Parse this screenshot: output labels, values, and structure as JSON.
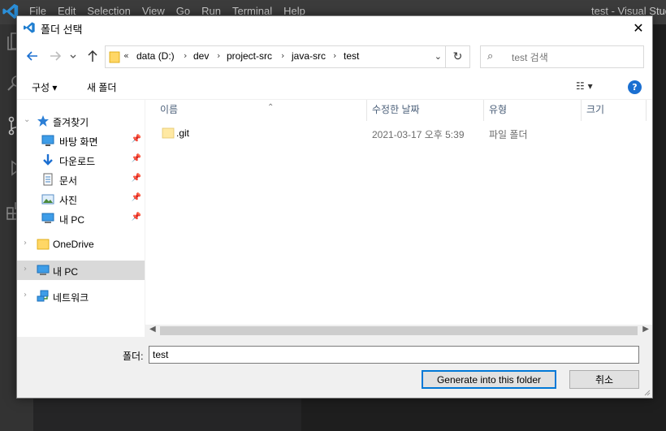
{
  "vscode": {
    "menu": [
      "File",
      "Edit",
      "Selection",
      "View",
      "Go",
      "Run",
      "Terminal",
      "Help"
    ],
    "window_title": "test - Visual Studi"
  },
  "dialog": {
    "title": "폴더 선택",
    "close": "✕",
    "address": {
      "overflow": "«",
      "crumbs": [
        "data (D:)",
        "dev",
        "project-src",
        "java-src",
        "test"
      ]
    },
    "search": {
      "placeholder": "test 검색"
    },
    "toolbar": {
      "organize": "구성 ▾",
      "new_folder": "새 폴더",
      "help": "?"
    },
    "nav_tree": {
      "quick_access": "즐겨찾기",
      "desktop": "바탕 화면",
      "downloads": "다운로드",
      "documents": "문서",
      "pictures": "사진",
      "this_pc_pinned": "내 PC",
      "onedrive": "OneDrive",
      "this_pc": "내 PC",
      "network": "네트워크"
    },
    "columns": {
      "name": "이름",
      "modified": "수정한 날짜",
      "type": "유형",
      "size": "크기"
    },
    "files": [
      {
        "name": ".git",
        "modified": "2021-03-17 오후 5:39",
        "type": "파일 폴더",
        "size": ""
      }
    ],
    "folder_label": "폴더:",
    "folder_value": "test",
    "buttons": {
      "primary": "Generate into this folder",
      "cancel": "취소"
    }
  }
}
